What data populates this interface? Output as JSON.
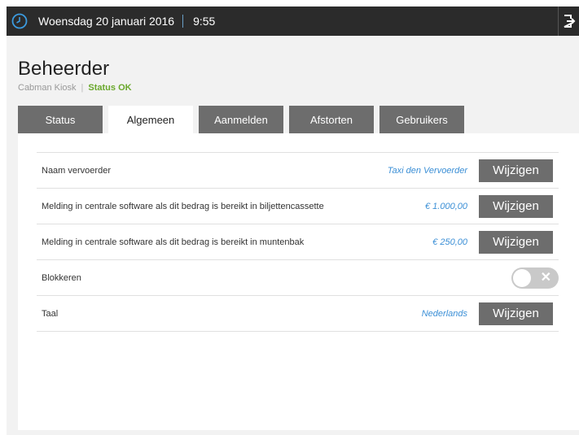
{
  "topbar": {
    "date": "Woensdag 20 januari 2016",
    "time": "9:55",
    "clock_icon": "clock-icon",
    "logout_icon": "logout-icon"
  },
  "header": {
    "title": "Beheerder",
    "subtitle": "Cabman Kiosk",
    "status": "Status OK"
  },
  "tabs": [
    {
      "label": "Status",
      "active": false
    },
    {
      "label": "Algemeen",
      "active": true
    },
    {
      "label": "Aanmelden",
      "active": false
    },
    {
      "label": "Afstorten",
      "active": false
    },
    {
      "label": "Gebruikers",
      "active": false
    }
  ],
  "settings": [
    {
      "label": "Naam vervoerder",
      "value": "Taxi den Vervoerder",
      "action": "Wijzigen"
    },
    {
      "label": "Melding in centrale software als dit bedrag is bereikt in biljettencassette",
      "value": "€ 1.000,00",
      "action": "Wijzigen"
    },
    {
      "label": "Melding in centrale software als dit bedrag is bereikt in muntenbak",
      "value": "€ 250,00",
      "action": "Wijzigen"
    },
    {
      "label": "Blokkeren",
      "toggle_on": false
    },
    {
      "label": "Taal",
      "value": "Nederlands",
      "action": "Wijzigen"
    }
  ],
  "colors": {
    "topbar": "#2b2b2b",
    "accent_blue": "#3b8fd6",
    "status_green": "#6aa82c",
    "button_gray": "#6d6d6d"
  }
}
